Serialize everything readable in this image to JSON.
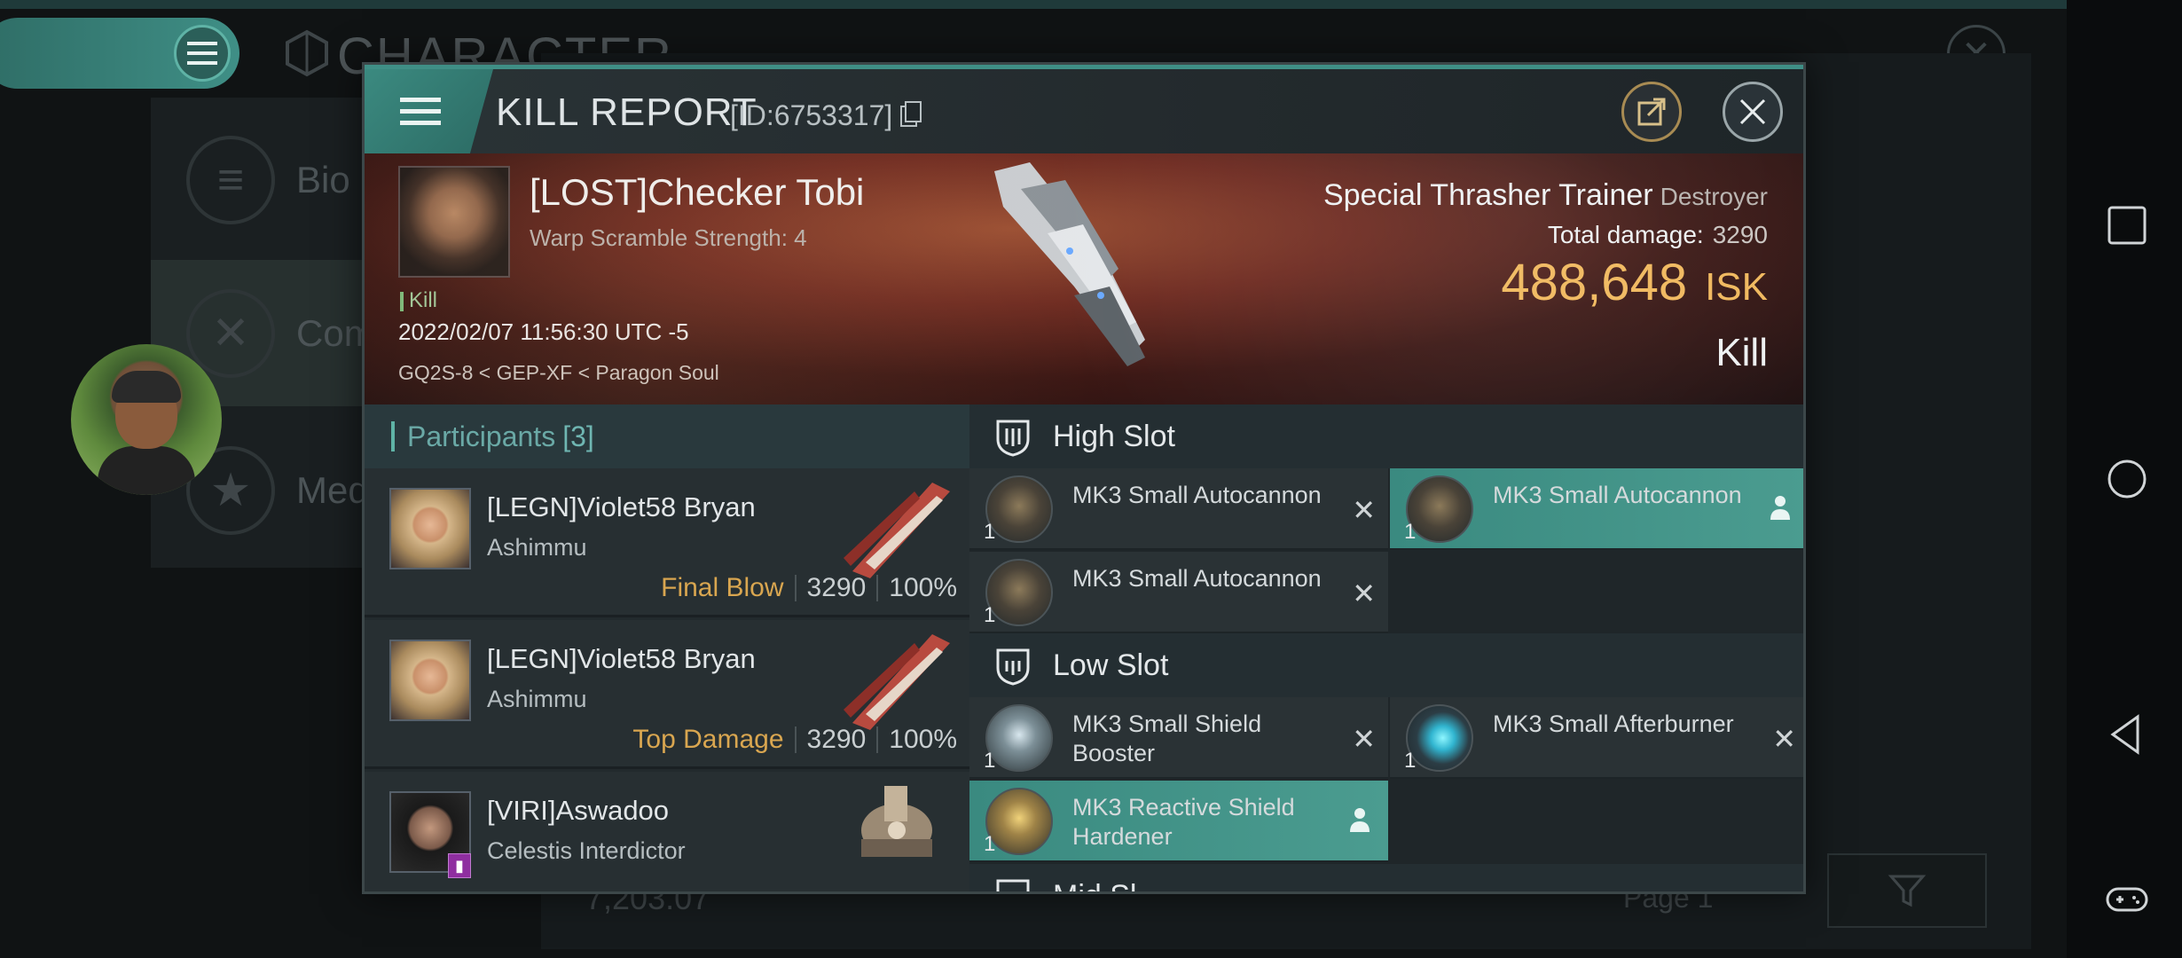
{
  "background": {
    "title": "CHARACTER",
    "sidebar": [
      {
        "label": "Bio",
        "icon": "list-icon"
      },
      {
        "label": "Com",
        "icon": "swords-icon"
      },
      {
        "label": "Med",
        "icon": "star-icon"
      }
    ],
    "footer_value": "7,203.07",
    "page_label": "Page 1"
  },
  "modal": {
    "title": "KILL REPORT",
    "report_id": "[ID:6753317]"
  },
  "victim": {
    "name": "[LOST]Checker Tobi",
    "warp": "Warp Scramble Strength: 4",
    "tag": "Kill",
    "datetime": "2022/02/07 11:56:30 UTC -5",
    "location": "GQ2S-8 < GEP-XF < Paragon Soul",
    "ship": "Special Thrasher Trainer",
    "ship_class": "Destroyer",
    "total_damage_label": "Total damage:",
    "total_damage": "3290",
    "isk_value": "488,648",
    "isk_unit": "ISK",
    "result": "Kill"
  },
  "participants": {
    "label": "Participants",
    "count": "[3]",
    "rows": [
      {
        "name": "[LEGN]Violet58 Bryan",
        "ship": "Ashimmu",
        "role": "Final Blow",
        "damage": "3290",
        "percent": "100%"
      },
      {
        "name": "[LEGN]Violet58 Bryan",
        "ship": "Ashimmu",
        "role": "Top Damage",
        "damage": "3290",
        "percent": "100%"
      },
      {
        "name": "[VIRI]Aswadoo",
        "ship": "Celestis Interdictor",
        "role": "",
        "damage": "",
        "percent": ""
      }
    ]
  },
  "fitting": {
    "high_slot": "High Slot",
    "low_slot": "Low Slot",
    "mid_slot_partial": "Mid Sl",
    "high": [
      {
        "name": "MK3 Small Autocannon",
        "qty": "1",
        "status": "destroyed"
      },
      {
        "name": "MK3 Small Autocannon",
        "qty": "1",
        "status": "dropped"
      },
      {
        "name": "MK3 Small Autocannon",
        "qty": "1",
        "status": "destroyed"
      }
    ],
    "low": [
      {
        "name": "MK3 Small Shield Booster",
        "qty": "1",
        "status": "destroyed"
      },
      {
        "name": "MK3 Small Afterburner",
        "qty": "1",
        "status": "destroyed"
      },
      {
        "name": "MK3 Reactive Shield Hardener",
        "qty": "1",
        "status": "dropped"
      }
    ]
  },
  "colors": {
    "accent": "#3f8f86",
    "isk": "#f0b75b",
    "role": "#d9a650",
    "dropped": "#4b9c90"
  }
}
